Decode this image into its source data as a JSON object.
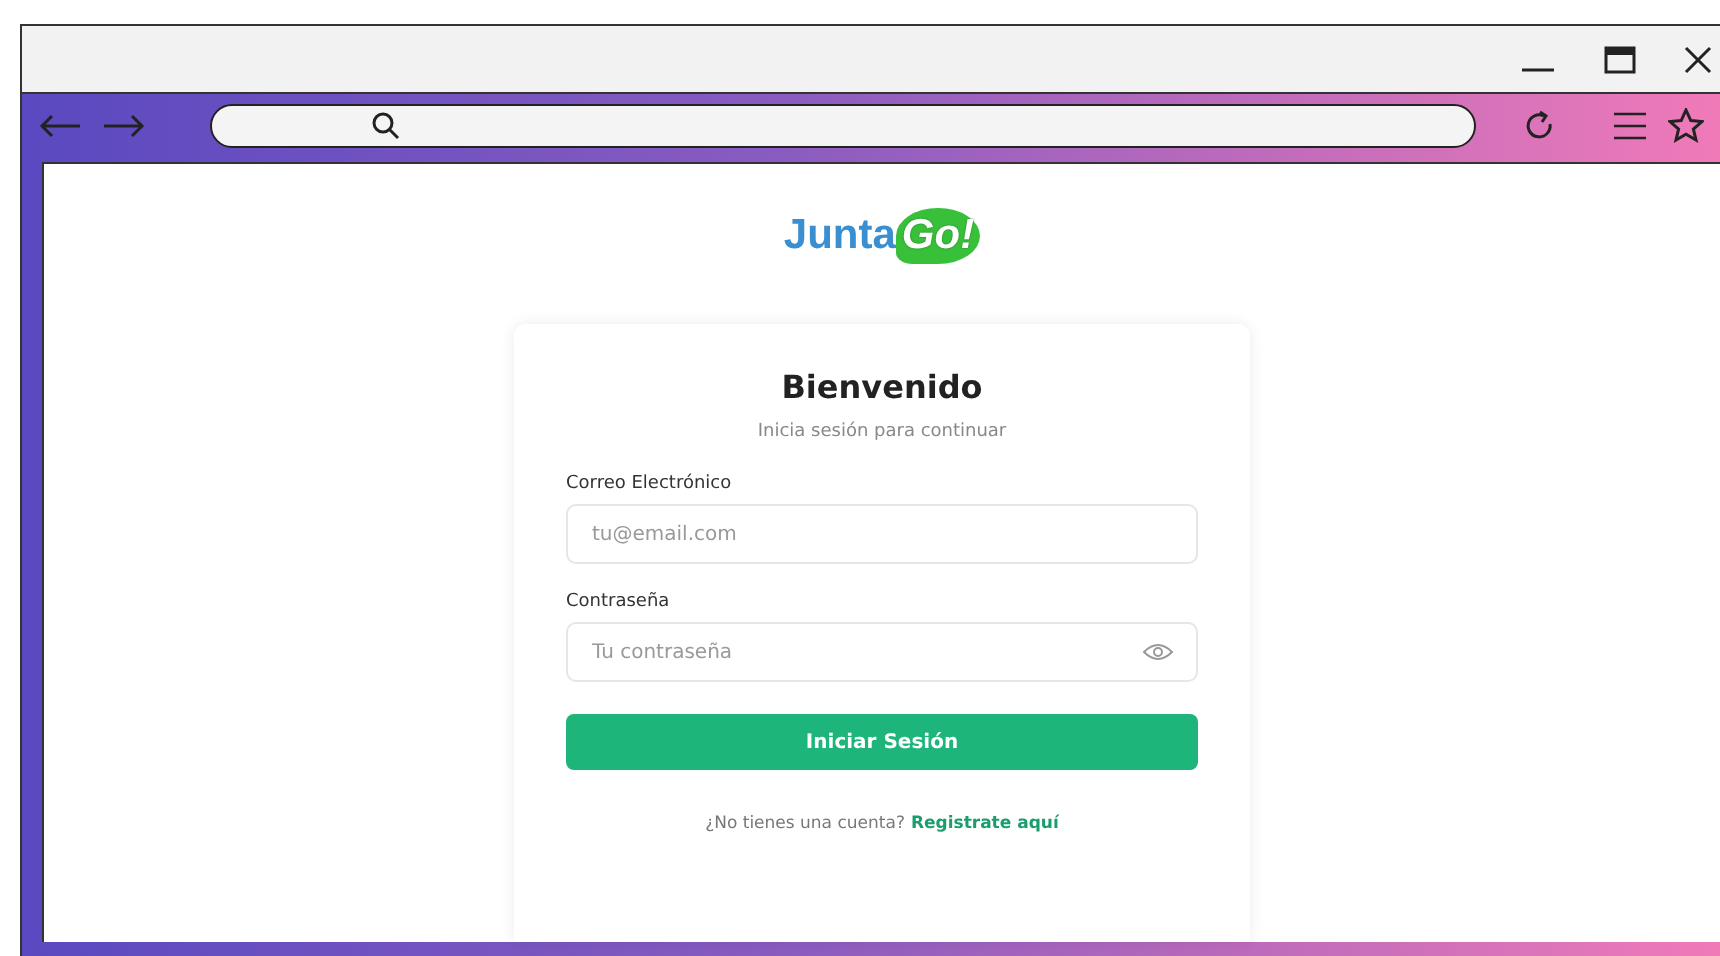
{
  "logo": {
    "first": "Junta",
    "second": "Go!"
  },
  "card": {
    "title": "Bienvenido",
    "subtitle": "Inicia sesión para continuar",
    "fields": [
      {
        "kind": "text",
        "label": "Correo Electrónico",
        "placeholder": "tu@email.com"
      },
      {
        "kind": "password",
        "label": "Contraseña",
        "placeholder": "Tu contraseña"
      }
    ],
    "button": "Iniciar Sesión",
    "footer": "¿No tienes una cuenta?",
    "link": "Registrate aquí"
  }
}
